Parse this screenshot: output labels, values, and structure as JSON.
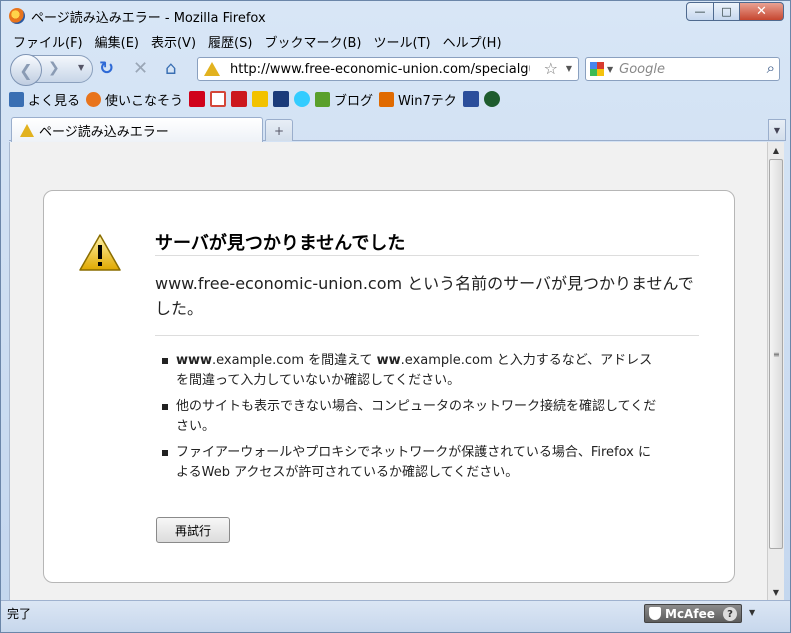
{
  "window": {
    "title": "ページ読み込みエラー - Mozilla Firefox",
    "controls": {
      "minimize": "—",
      "maximize": "□",
      "close": "✕"
    }
  },
  "menu": [
    "ファイル(F)",
    "編集(E)",
    "表示(V)",
    "履歴(S)",
    "ブックマーク(B)",
    "ツール(T)",
    "ヘルプ(H)"
  ],
  "nav": {
    "url": "http://www.free-economic-union.com/specialguest/",
    "search_placeholder": "Google"
  },
  "bookmarks": [
    {
      "label": "よく見る",
      "icon": "magnifier-icon",
      "color": "#3a6fb3"
    },
    {
      "label": "使いこなそう",
      "icon": "firefox-icon",
      "color": "#e8741c"
    },
    {
      "label": "",
      "icon": "yahoo-icon",
      "color": "#d0021b"
    },
    {
      "label": "",
      "icon": "gmail-icon",
      "color": "#d44638"
    },
    {
      "label": "",
      "icon": "youtube-icon",
      "color": "#cc181e"
    },
    {
      "label": "",
      "icon": "bookmark-yellow-icon",
      "color": "#f2c200"
    },
    {
      "label": "",
      "icon": "u-icon",
      "color": "#1b3b7a"
    },
    {
      "label": "",
      "icon": "twitter-icon",
      "color": "#33ccff"
    },
    {
      "label": "ブログ",
      "icon": "blog-icon",
      "color": "#5aa02c"
    },
    {
      "label": "Win7テク",
      "icon": "win7-icon",
      "color": "#e06a00"
    },
    {
      "label": "",
      "icon": "ww-icon",
      "color": "#2b4e9b"
    },
    {
      "label": "",
      "icon": "n-icon",
      "color": "#1e5c2e"
    }
  ],
  "tab": {
    "label": "ページ読み込みエラー"
  },
  "error": {
    "title": "サーバが見つかりませんでした",
    "description": "www.free-economic-union.com という名前のサーバが見つかりませんでした。",
    "tips": [
      {
        "bold": "www",
        "text1": ".example.com を間違えて ",
        "bold2": "ww",
        "text2": ".example.com と入力するなど、アドレスを間違って入力していないか確認してください。"
      },
      {
        "bold": "",
        "text1": "他のサイトも表示できない場合、コンピュータのネットワーク接続を確認してください。",
        "bold2": "",
        "text2": ""
      },
      {
        "bold": "",
        "text1": "ファイアーウォールやプロキシでネットワークが保護されている場合、Firefox によるWeb アクセスが許可されているか確認してください。",
        "bold2": "",
        "text2": ""
      }
    ],
    "retry_label": "再試行"
  },
  "status": {
    "text": "完了",
    "mcafee_label": "McAfee",
    "help": "?"
  },
  "colors": {
    "accent": "#3a6fb3",
    "warning": "#e2b21f"
  }
}
